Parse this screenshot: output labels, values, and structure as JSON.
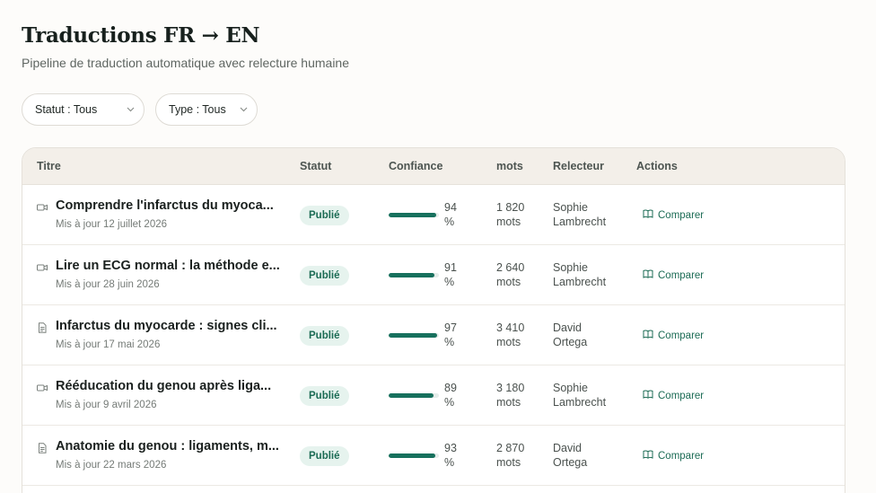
{
  "header": {
    "title": "Traductions FR → EN",
    "subtitle": "Pipeline de traduction automatique avec relecture humaine"
  },
  "filters": [
    {
      "label": "Statut : Tous"
    },
    {
      "label": "Type : Tous"
    }
  ],
  "table": {
    "columns": {
      "title": "Titre",
      "status": "Statut",
      "confidence": "Confiance",
      "words": "mots",
      "reviewer": "Relecteur",
      "actions": "Actions"
    },
    "rows": [
      {
        "icon": "video-icon",
        "title": "Comprendre l'infarctus du myoca...",
        "date": "Mis à jour 12 juillet 2026",
        "status": "Publié",
        "confidence_value": 94,
        "confidence_num": "94",
        "confidence_unit": "%",
        "words_num": "1 820",
        "words_unit": "mots",
        "reviewer_first": "Sophie",
        "reviewer_last": "Lambrecht",
        "action": "Comparer"
      },
      {
        "icon": "video-icon",
        "title": "Lire un ECG normal : la méthode e...",
        "date": "Mis à jour 28 juin 2026",
        "status": "Publié",
        "confidence_value": 91,
        "confidence_num": "91",
        "confidence_unit": "%",
        "words_num": "2 640",
        "words_unit": "mots",
        "reviewer_first": "Sophie",
        "reviewer_last": "Lambrecht",
        "action": "Comparer"
      },
      {
        "icon": "document-icon",
        "title": "Infarctus du myocarde : signes cli...",
        "date": "Mis à jour 17 mai 2026",
        "status": "Publié",
        "confidence_value": 97,
        "confidence_num": "97",
        "confidence_unit": "%",
        "words_num": "3 410",
        "words_unit": "mots",
        "reviewer_first": "David",
        "reviewer_last": "Ortega",
        "action": "Comparer"
      },
      {
        "icon": "video-icon",
        "title": "Rééducation du genou après liga...",
        "date": "Mis à jour 9 avril 2026",
        "status": "Publié",
        "confidence_value": 89,
        "confidence_num": "89",
        "confidence_unit": "%",
        "words_num": "3 180",
        "words_unit": "mots",
        "reviewer_first": "Sophie",
        "reviewer_last": "Lambrecht",
        "action": "Comparer"
      },
      {
        "icon": "document-icon",
        "title": "Anatomie du genou : ligaments, m...",
        "date": "Mis à jour 22 mars 2026",
        "status": "Publié",
        "confidence_value": 93,
        "confidence_num": "93",
        "confidence_unit": "%",
        "words_num": "2 870",
        "words_unit": "mots",
        "reviewer_first": "David",
        "reviewer_last": "Ortega",
        "action": "Comparer"
      }
    ]
  },
  "colors": {
    "accent": "#1b6b54",
    "bar": "#17705d",
    "badge_bg": "#e6f3ee",
    "header_bg": "#f3efe9"
  }
}
